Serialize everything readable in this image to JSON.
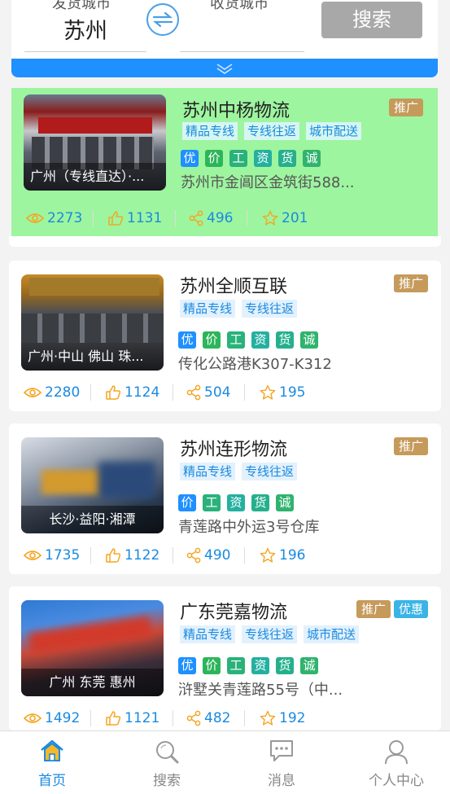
{
  "search": {
    "from_label": "发货城市",
    "to_label": "收货城市",
    "from_city": "苏州",
    "to_city": "",
    "search_button": "搜索"
  },
  "cards": [
    {
      "title": "苏州中杨物流",
      "badges": [
        "推广"
      ],
      "tags": [
        "精品专线",
        "专线往返",
        "城市配送"
      ],
      "creds": [
        "优",
        "价",
        "工",
        "资",
        "货",
        "诚"
      ],
      "address": "苏州市金阊区金筑街588...",
      "caption": "广州（专线直达）·...",
      "views": "2273",
      "likes": "1131",
      "shares": "496",
      "stars": "201"
    },
    {
      "title": "苏州全顺互联",
      "badges": [
        "推广"
      ],
      "tags": [
        "精品专线",
        "专线往返"
      ],
      "creds": [
        "优",
        "价",
        "工",
        "资",
        "货",
        "诚"
      ],
      "address": "传化公路港K307-K312",
      "caption": "广州·中山 佛山 珠...",
      "views": "2280",
      "likes": "1124",
      "shares": "504",
      "stars": "195"
    },
    {
      "title": "苏州连形物流",
      "badges": [
        "推广"
      ],
      "tags": [
        "精品专线",
        "专线往返"
      ],
      "creds": [
        "价",
        "工",
        "资",
        "货",
        "诚"
      ],
      "address": "青莲路中外运3号仓库",
      "caption": "长沙·益阳·湘潭",
      "views": "1735",
      "likes": "1122",
      "shares": "490",
      "stars": "196"
    },
    {
      "title": "广东莞嘉物流",
      "badges": [
        "推广",
        "优惠"
      ],
      "tags": [
        "精品专线",
        "专线往返",
        "城市配送"
      ],
      "creds": [
        "优",
        "价",
        "工",
        "资",
        "货",
        "诚"
      ],
      "address": "浒墅关青莲路55号（中...",
      "caption": "广州 东莞 惠州",
      "views": "1492",
      "likes": "1121",
      "shares": "482",
      "stars": "192"
    }
  ],
  "nav": {
    "home": "首页",
    "search": "搜索",
    "messages": "消息",
    "profile": "个人中心"
  },
  "colors": {
    "accent": "#1a8ae0",
    "highlight_card": "#9df59f",
    "promo_badge": "#c59a5a",
    "discount_badge": "#3ab4e6",
    "search_button": "#a8a8a8",
    "star_icon": "#f5a623"
  }
}
